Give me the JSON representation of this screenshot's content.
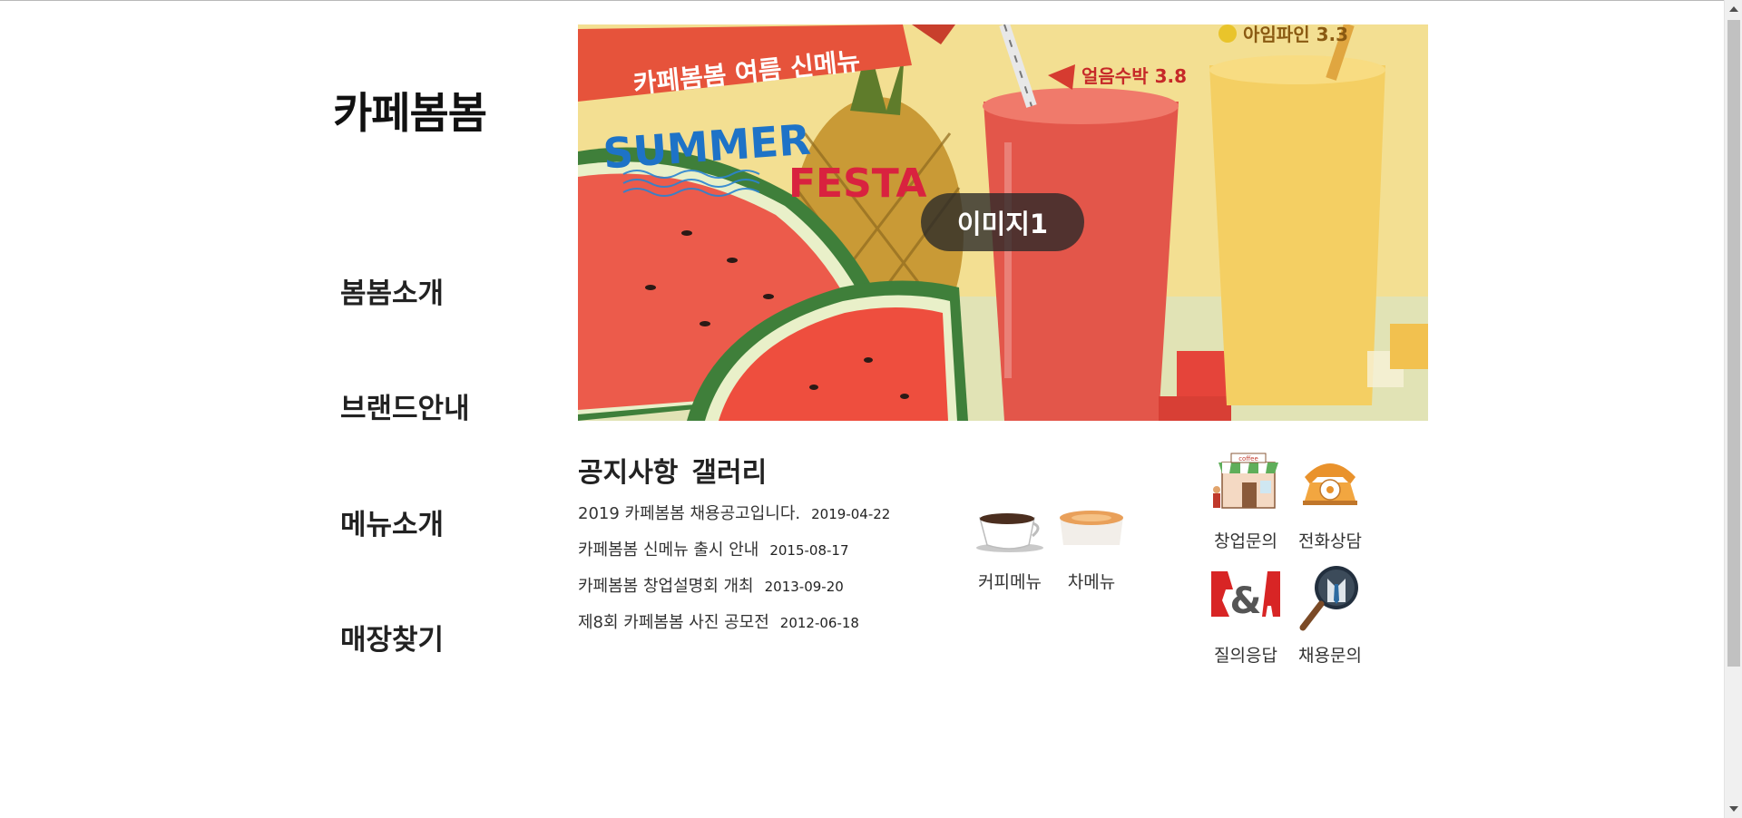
{
  "brand": {
    "logo_text": "카페봄봄"
  },
  "nav": {
    "items": [
      {
        "label": "봄봄소개"
      },
      {
        "label": "브랜드안내"
      },
      {
        "label": "메뉴소개"
      },
      {
        "label": "매장찾기"
      }
    ]
  },
  "hero": {
    "banner_title": "카페봄봄 여름 신메뉴",
    "festa_summer": "SUMMER",
    "festa_text": "FESTA",
    "watermelon_label": "얼음수박 3.8",
    "pineapple_label": "아임파인 3.3",
    "caption": "이미지1"
  },
  "notice": {
    "tabs": [
      "공지사항",
      "갤러리"
    ],
    "items": [
      {
        "title": "2019 카페봄봄 채용공고입니다.",
        "date": "2019-04-22"
      },
      {
        "title": "카페봄봄 신메뉴 출시 안내",
        "date": "2015-08-17"
      },
      {
        "title": "카페봄봄 창업설명회 개최",
        "date": "2013-09-20"
      },
      {
        "title": "제8회 카페봄봄 사진 공모전",
        "date": "2012-06-18"
      }
    ]
  },
  "menu_links": [
    {
      "label": "커피메뉴",
      "icon": "coffee-cup-icon"
    },
    {
      "label": "차메뉴",
      "icon": "tea-cup-icon"
    }
  ],
  "quick_links": [
    {
      "label": "창업문의",
      "icon": "storefront-icon"
    },
    {
      "label": "전화상담",
      "icon": "telephone-icon"
    },
    {
      "label": "질의응답",
      "icon": "qna-icon"
    },
    {
      "label": "채용문의",
      "icon": "magnifier-person-icon"
    }
  ]
}
